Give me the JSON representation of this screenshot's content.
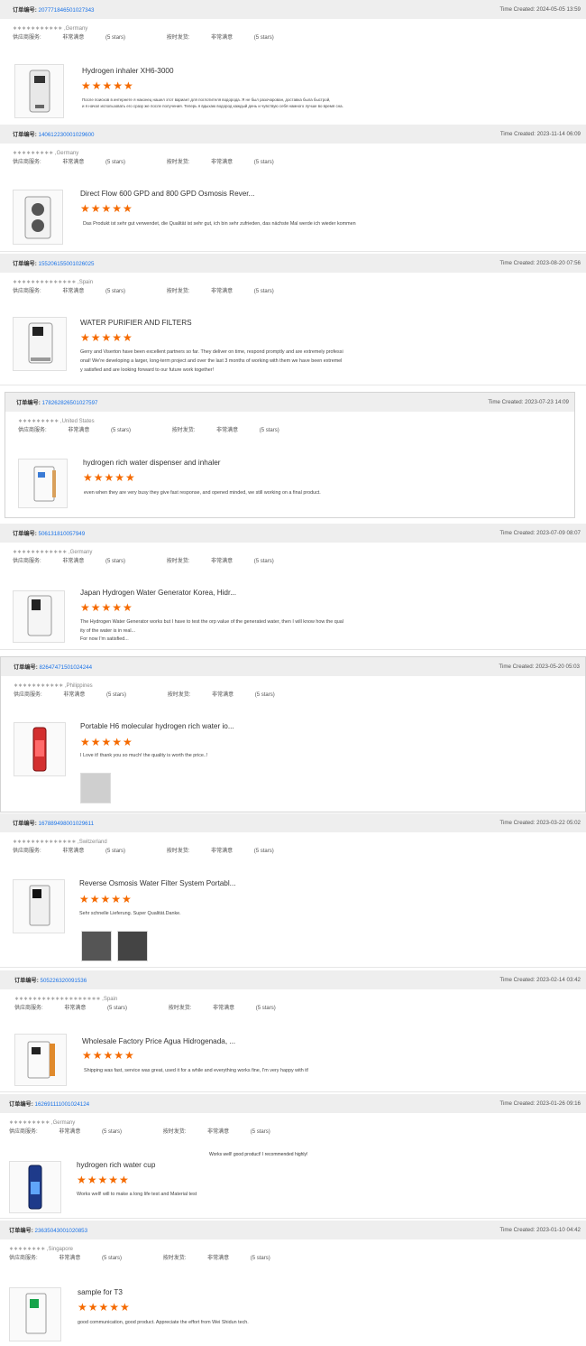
{
  "labels": {
    "order": "订单编号:",
    "time_prefix": "Time Created:",
    "supplier": "供应商服务:",
    "ontime": "按时发货:",
    "rating": "非常满意",
    "rating_stars": "(5 stars)",
    "stars": "★★★★★"
  },
  "reviews": [
    {
      "order_no": "207771846501027343",
      "time": "2024-05-05 13:59",
      "buyer": "∗∗∗∗∗∗∗∗∗∗∗ ,Germany",
      "product": "Hydrogen inhaler  XH6-3000",
      "comment": "После поисков в интернете я наконец нашел этот вариант для поглотителя водорода. Я не был разочарован, доставка была быстрой,\nи я начал использовать его сразу же после получения. Теперь я вдыхаю водород каждый день и чувствую себя намного лучше во время сна."
    },
    {
      "order_no": "140612230001029600",
      "time": "2023-11-14 06:09",
      "buyer": "∗∗∗∗∗∗∗∗∗ ,Germany",
      "product": "Direct Flow 600 GPD and 800 GPD Osmosis Rever...",
      "comment": "Das Produkt ist sehr gut verwendet, die Qualität ist sehr gut, ich bin sehr zufrieden, das nächste Mal werde ich wieder kommen"
    },
    {
      "order_no": "155206155001026025",
      "time": "2023-08-20 07:56",
      "buyer": "∗∗∗∗∗∗∗∗∗∗∗∗∗∗ ,Spain",
      "product": "WATER PURIFIER AND FILTERS",
      "comment": "Gerry and Viserton have been excellent partners so far. They deliver on time, respond promptly and are extremely professi\nonal! We're developing a larger, long-term project and over the last 3 months of working with them we have been extremel\ny satisfied and are looking forward to our future work together!"
    },
    {
      "order_no": "178262826501027597",
      "time": "2023-07-23 14:09",
      "buyer": "∗∗∗∗∗∗∗∗∗ ,United States",
      "product": "hydrogen rich water dispenser and inhaler",
      "comment": "even when they are very busy they give fast response, and opened minded, we still working on a final product."
    },
    {
      "order_no": "506131810057949",
      "time": "2023-07-09 08:07",
      "buyer": "∗∗∗∗∗∗∗∗∗∗∗∗ ,Germany",
      "product": "Japan Hydrogen Water Generator Korea, Hidr...",
      "comment": "The Hydrogen Water Generator works but I have to test the orp value of the generated water, then I will know how the qual\nity of the water is in real...\nFor now I'm satisfied..."
    },
    {
      "order_no": "826474715010242​44",
      "time": "2023-05-20 05:03",
      "buyer": "∗∗∗∗∗∗∗∗∗∗∗ ,Philippines",
      "product": "Portable H6 molecular hydrogen rich water io...",
      "comment": "I Love it! thank you so much! the quality is worth the price..!"
    },
    {
      "order_no": "167889498001029611",
      "time": "2023-03-22 05:02",
      "buyer": "∗∗∗∗∗∗∗∗∗∗∗∗∗∗ ,Switzerland",
      "product": "Reverse Osmosis Water Filter System Portabl...",
      "comment": "Sehr schnelle Lieferung. Super Qualität.Danke."
    },
    {
      "order_no": "505226320091536",
      "time": "2023-02-14 03:42",
      "buyer": "∗∗∗∗∗∗∗∗∗∗∗∗∗∗∗∗∗∗∗ ,Spain",
      "product": "Wholesale Factory Price Agua Hidrogenada, ...",
      "comment": "Shipping was fast, service was great, used it for a while and everything works fine, I'm very happy with it!"
    },
    {
      "order_no": "162691111001024124",
      "time": "2023-01-26 09:16",
      "buyer": "∗∗∗∗∗∗∗∗∗ ,Germany",
      "product": "hydrogen rich water cup",
      "comment": "Works well! will to make a long life test and Material test",
      "note": "Works well! good product! I recommended highly!"
    },
    {
      "order_no": "236350430010208​53",
      "time": "2023-01-10 04:42",
      "buyer": "∗∗∗∗∗∗∗∗ ,Singapore",
      "product": "sample for T3",
      "comment": "good communication, good product. Appreciate the effort from Wei Shidun tech."
    }
  ],
  "colors": {
    "star": "#f56a00",
    "order_link": "#1a73e8",
    "header_bg": "#eeeeee"
  },
  "icons": [
    "inhaler-product-icon",
    "ro-filter-product-icon",
    "water-purifier-product-icon",
    "dispenser-product-icon",
    "generator-product-icon",
    "hydrogen-bottle-product-icon",
    "ro-system-product-icon",
    "agua-dispenser-product-icon",
    "water-cup-product-icon",
    "t3-dispenser-product-icon"
  ]
}
